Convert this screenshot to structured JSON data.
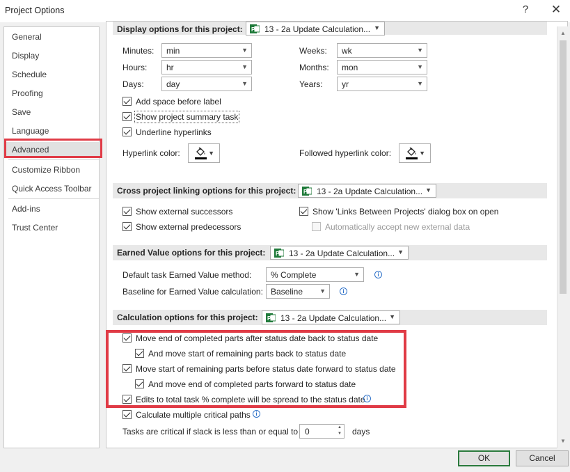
{
  "window": {
    "title": "Project Options",
    "help_glyph": "?",
    "close_glyph": "✕"
  },
  "sidebar": {
    "items": [
      {
        "label": "General"
      },
      {
        "label": "Display"
      },
      {
        "label": "Schedule"
      },
      {
        "label": "Proofing"
      },
      {
        "label": "Save"
      },
      {
        "label": "Language"
      },
      {
        "label": "Advanced"
      },
      {
        "label": "Customize Ribbon"
      },
      {
        "label": "Quick Access Toolbar"
      },
      {
        "label": "Add-ins"
      },
      {
        "label": "Trust Center"
      }
    ],
    "active": "Advanced"
  },
  "project_name": "13 - 2a Update Calculation...",
  "display_section": {
    "header": "Display options for this project:",
    "minutes_label": "Minutes:",
    "minutes_value": "min",
    "hours_label": "Hours:",
    "hours_value": "hr",
    "days_label": "Days:",
    "days_value": "day",
    "weeks_label": "Weeks:",
    "weeks_value": "wk",
    "months_label": "Months:",
    "months_value": "mon",
    "years_label": "Years:",
    "years_value": "yr",
    "add_space_label": "Add space before label",
    "show_summary_label": "Show project summary task",
    "underline_label": "Underline hyperlinks",
    "hyperlink_color_label": "Hyperlink color:",
    "followed_color_label": "Followed hyperlink color:"
  },
  "cross_section": {
    "header": "Cross project linking options for this project:",
    "ext_successors": "Show external successors",
    "ext_predecessors": "Show external predecessors",
    "links_dialog": "Show 'Links Between Projects' dialog box on open",
    "auto_accept": "Automatically accept new external data"
  },
  "ev_section": {
    "header": "Earned Value options for this project:",
    "method_label": "Default task Earned Value method:",
    "method_value": "% Complete",
    "baseline_label": "Baseline for Earned Value calculation:",
    "baseline_value": "Baseline"
  },
  "calc_section": {
    "header": "Calculation options for this project:",
    "opt1": "Move end of completed parts after status date back to status date",
    "opt1a": "And move start of remaining parts back to status date",
    "opt2": "Move start of remaining parts before status date forward to status date",
    "opt2a": "And move end of completed parts forward to status date",
    "opt3": "Edits to total task % complete will be spread to the status date",
    "opt4": "Calculate multiple critical paths",
    "slack_label": "Tasks are critical if slack is less than or equal to",
    "slack_value": "0",
    "slack_unit": "days"
  },
  "footer": {
    "ok": "OK",
    "cancel": "Cancel"
  }
}
